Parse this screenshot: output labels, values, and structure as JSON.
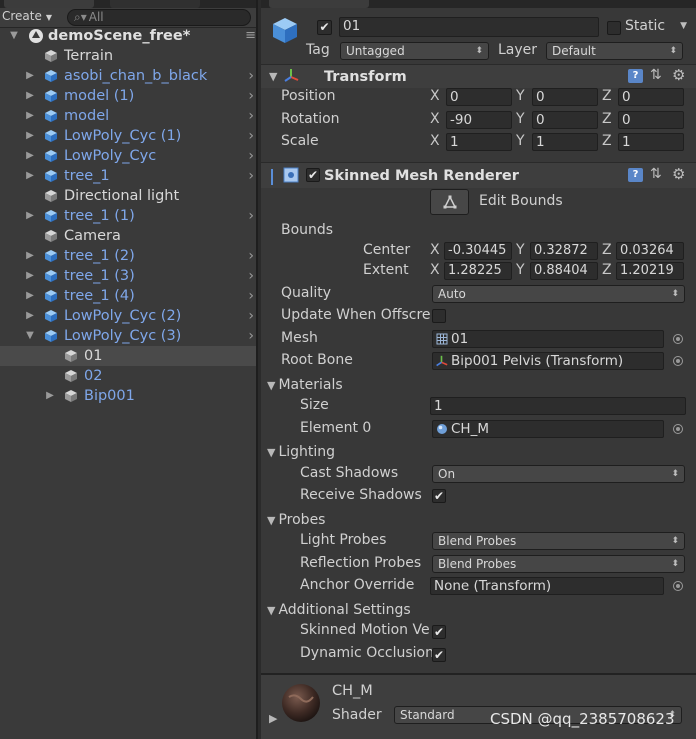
{
  "hierarchy": {
    "create_label": "Create",
    "search_placeholder": "All",
    "scene": "demoScene_free*",
    "items": [
      {
        "label": "Terrain",
        "color": "white",
        "expandable": false,
        "arrow": false
      },
      {
        "label": "asobi_chan_b_black",
        "color": "blue",
        "expandable": true,
        "arrow": true
      },
      {
        "label": "model (1)",
        "color": "blue",
        "expandable": true,
        "arrow": true
      },
      {
        "label": "model",
        "color": "blue",
        "expandable": true,
        "arrow": true
      },
      {
        "label": "LowPoly_Cyc (1)",
        "color": "blue",
        "expandable": true,
        "arrow": true
      },
      {
        "label": "LowPoly_Cyc",
        "color": "blue",
        "expandable": true,
        "arrow": true
      },
      {
        "label": "tree_1",
        "color": "blue",
        "expandable": true,
        "arrow": true
      },
      {
        "label": "Directional light",
        "color": "white",
        "expandable": false,
        "arrow": false
      },
      {
        "label": "tree_1 (1)",
        "color": "blue",
        "expandable": true,
        "arrow": true
      },
      {
        "label": "Camera",
        "color": "white",
        "expandable": false,
        "arrow": false
      },
      {
        "label": "tree_1 (2)",
        "color": "blue",
        "expandable": true,
        "arrow": true
      },
      {
        "label": "tree_1 (3)",
        "color": "blue",
        "expandable": true,
        "arrow": true
      },
      {
        "label": "tree_1 (4)",
        "color": "blue",
        "expandable": true,
        "arrow": true
      },
      {
        "label": "LowPoly_Cyc (2)",
        "color": "blue",
        "expandable": true,
        "arrow": true
      },
      {
        "label": "LowPoly_Cyc (3)",
        "color": "blue",
        "expandable": true,
        "expanded": true,
        "arrow": true
      },
      {
        "label": "01",
        "color": "white",
        "depth": 1,
        "selected": true
      },
      {
        "label": "02",
        "color": "blue",
        "depth": 1
      },
      {
        "label": "Bip001",
        "color": "blue",
        "depth": 1,
        "expandable": true
      }
    ]
  },
  "inspector": {
    "object_name": "01",
    "static_label": "Static",
    "tag_label": "Tag",
    "tag_value": "Untagged",
    "layer_label": "Layer",
    "layer_value": "Default",
    "transform": {
      "title": "Transform",
      "position_label": "Position",
      "position": [
        "0",
        "0",
        "0"
      ],
      "rotation_label": "Rotation",
      "rotation": [
        "-90",
        "0",
        "0"
      ],
      "scale_label": "Scale",
      "scale": [
        "1",
        "1",
        "1"
      ]
    },
    "axes": [
      "X",
      "Y",
      "Z"
    ],
    "smr": {
      "title": "Skinned Mesh Renderer",
      "edit_bounds": "Edit Bounds",
      "bounds_label": "Bounds",
      "center_label": "Center",
      "center": [
        "-0.30445",
        "0.32872",
        "0.03264"
      ],
      "extent_label": "Extent",
      "extent": [
        "1.28225",
        "0.88404",
        "1.20219"
      ],
      "quality_label": "Quality",
      "quality_value": "Auto",
      "update_label": "Update When Offscre",
      "mesh_label": "Mesh",
      "mesh_value": "01",
      "root_bone_label": "Root Bone",
      "root_bone_value": "Bip001 Pelvis (Transform)",
      "materials_label": "Materials",
      "size_label": "Size",
      "size_value": "1",
      "element0_label": "Element 0",
      "element0_value": "CH_M",
      "lighting_label": "Lighting",
      "cast_label": "Cast Shadows",
      "cast_value": "On",
      "receive_label": "Receive Shadows",
      "probes_label": "Probes",
      "light_probes_label": "Light Probes",
      "light_probes_value": "Blend Probes",
      "reflection_label": "Reflection Probes",
      "reflection_value": "Blend Probes",
      "anchor_label": "Anchor Override",
      "anchor_value": "None (Transform)",
      "additional_label": "Additional Settings",
      "motion_label": "Skinned Motion Ve",
      "occlusion_label": "Dynamic Occlusion"
    },
    "material": {
      "name": "CH_M",
      "shader_label": "Shader",
      "shader_value": "Standard"
    }
  },
  "watermark": "CSDN @qq_2385708623",
  "colors": {
    "link_blue": "#7fa7ea",
    "bg": "#383838"
  }
}
